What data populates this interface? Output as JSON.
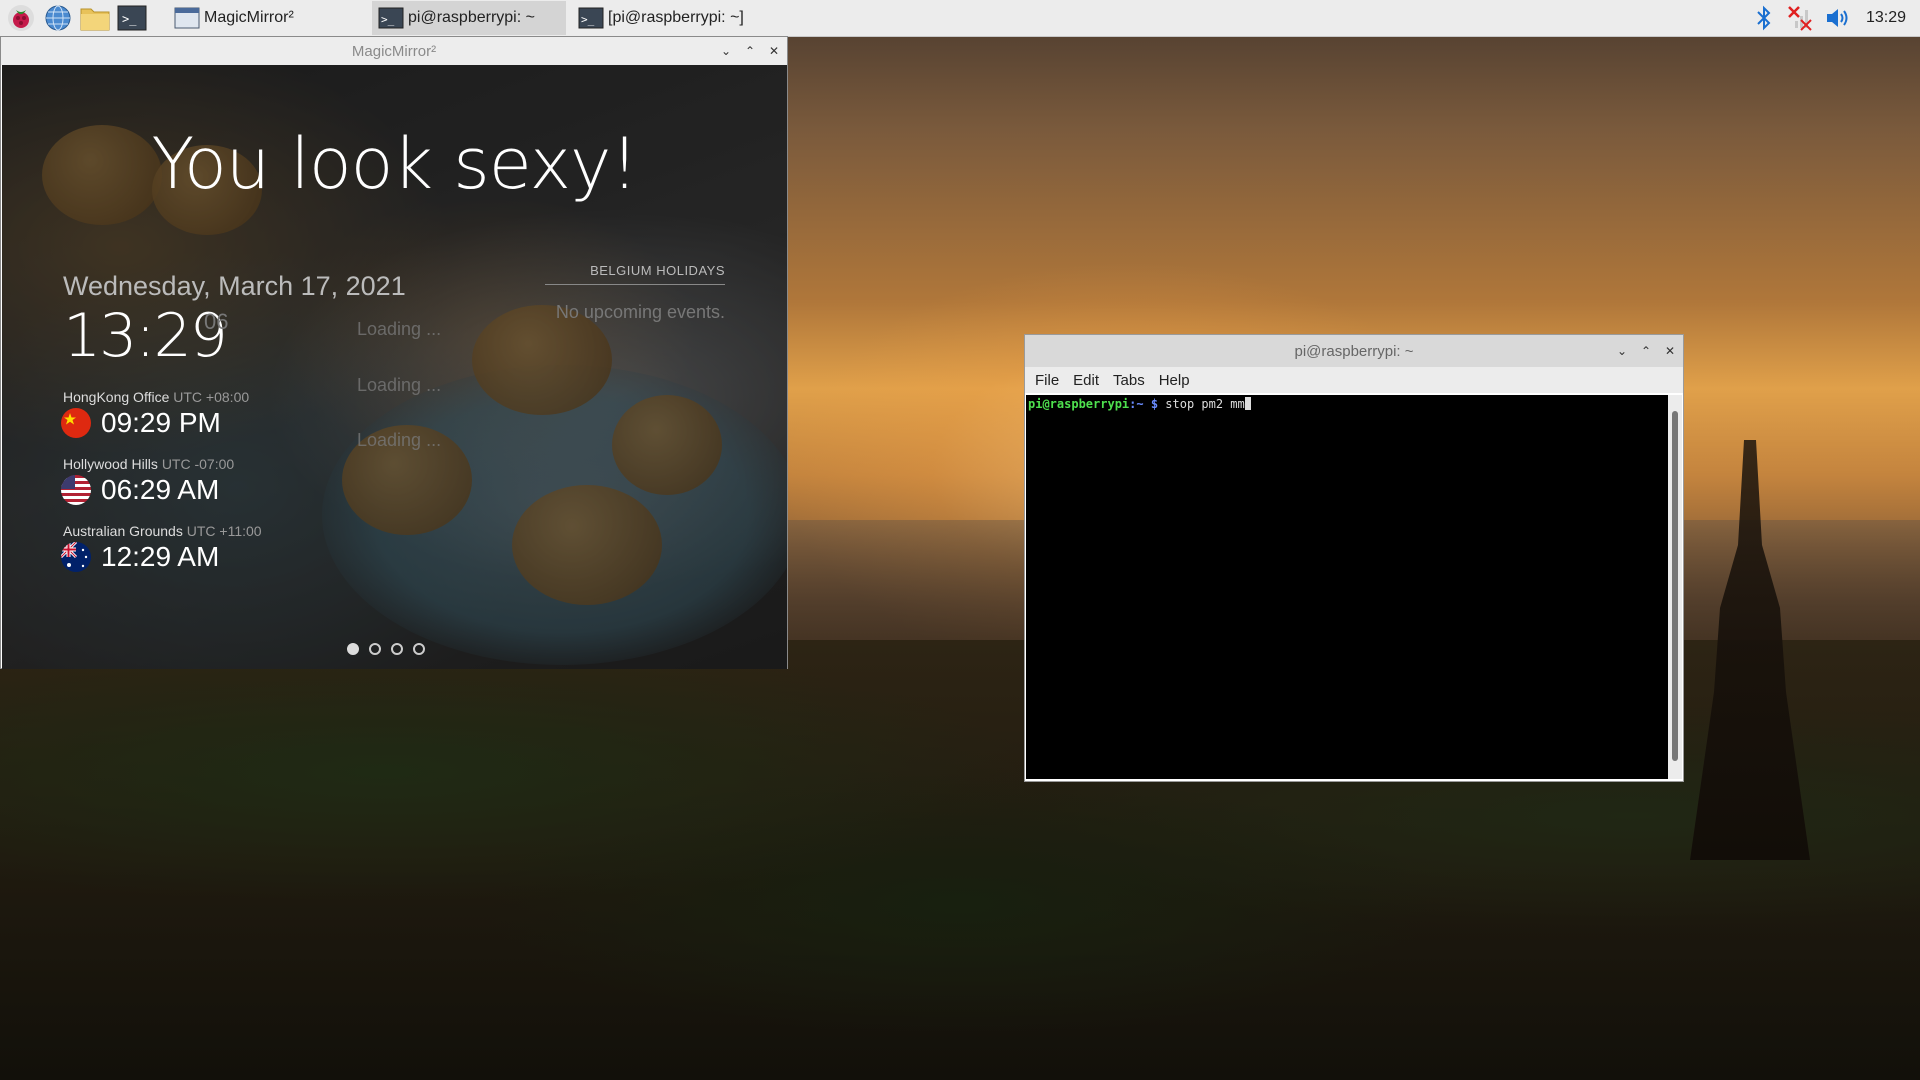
{
  "taskbar": {
    "tasks": [
      {
        "label": "MagicMirror²"
      },
      {
        "label": "pi@raspberrypi: ~"
      },
      {
        "label": "[pi@raspberrypi: ~]"
      }
    ],
    "clock": "13:29"
  },
  "magicmirror_window": {
    "title": "MagicMirror²",
    "compliment": "You look sexy!",
    "date": "Wednesday, March 17, 2021",
    "time": "13:29",
    "seconds": "06",
    "loading": [
      "Loading ...",
      "Loading ...",
      "Loading ..."
    ],
    "world_clocks": [
      {
        "name": "HongKong Office",
        "offset": "UTC +08:00",
        "time": "09:29 PM"
      },
      {
        "name": "Hollywood Hills",
        "offset": "UTC -07:00",
        "time": "06:29 AM"
      },
      {
        "name": "Australian Grounds",
        "offset": "UTC +11:00",
        "time": "12:29 AM"
      }
    ],
    "calendar": {
      "header": "BELGIUM HOLIDAYS",
      "empty": "No upcoming events."
    },
    "page_dots": 4
  },
  "terminal_window": {
    "title": "pi@raspberrypi: ~",
    "menu": [
      "File",
      "Edit",
      "Tabs",
      "Help"
    ],
    "prompt_user": "pi@raspberrypi",
    "prompt_path": ":~ $",
    "command": " stop pm2 mm"
  }
}
